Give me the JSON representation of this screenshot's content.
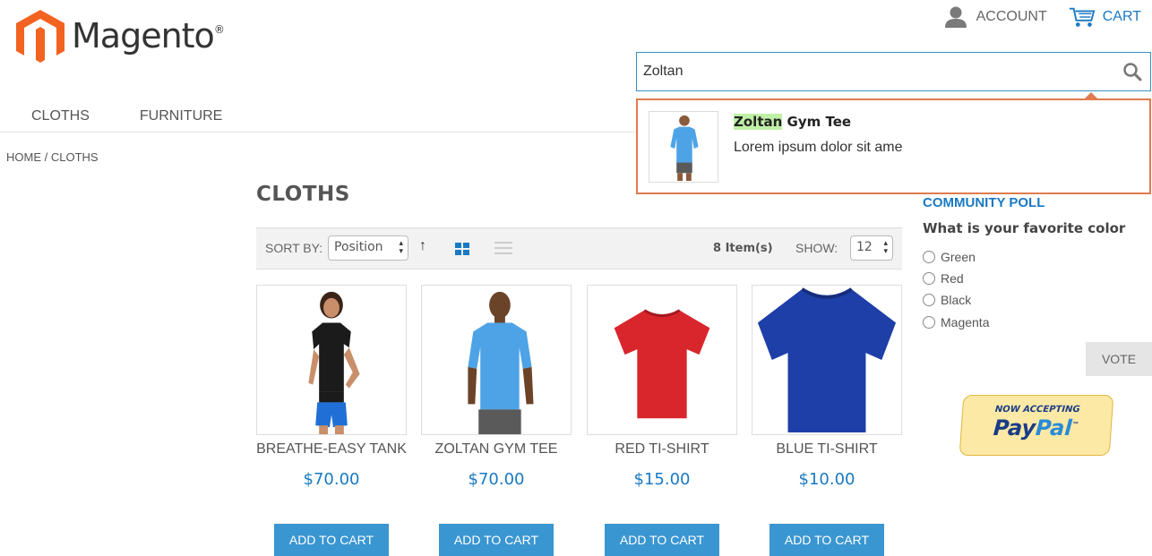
{
  "header": {
    "logo_text": "Magento",
    "logo_mark": "®",
    "account_label": "ACCOUNT",
    "cart_label": "CART"
  },
  "search": {
    "value": "Zoltan",
    "placeholder": ""
  },
  "suggestion": {
    "name_highlight": "Zoltan",
    "name_rest": " Gym Tee",
    "description": "Lorem ipsum dolor sit ame"
  },
  "nav": {
    "items": [
      {
        "label": "CLOTHS"
      },
      {
        "label": "FURNITURE"
      }
    ]
  },
  "breadcrumb": "HOME / CLOTHS",
  "page_title": "CLOTHS",
  "toolbar": {
    "sort_label": "SORT BY:",
    "sort_value": "Position",
    "sort_direction": "↑",
    "items_count": "8 Item(s)",
    "show_label": "SHOW:",
    "show_value": "12"
  },
  "products": [
    {
      "name": "BREATHE-EASY TANK",
      "price": "$70.00",
      "button": "ADD TO CART"
    },
    {
      "name": "ZOLTAN GYM TEE",
      "price": "$70.00",
      "button": "ADD TO CART"
    },
    {
      "name": "RED TI-SHIRT",
      "price": "$15.00",
      "button": "ADD TO CART"
    },
    {
      "name": "BLUE TI-SHIRT",
      "price": "$10.00",
      "button": "ADD TO CART"
    }
  ],
  "poll": {
    "title": "COMMUNITY POLL",
    "question": "What is your favorite color",
    "options": [
      "Green",
      "Red",
      "Black",
      "Magenta"
    ],
    "vote_label": "VOTE"
  },
  "paypal": {
    "top_text": "NOW ACCEPTING",
    "brand_pay": "Pay",
    "brand_pal": "Pal",
    "brand_tm": "™"
  },
  "colors": {
    "accent": "#1979c3",
    "button": "#3a96d1",
    "brand_orange": "#f26322",
    "dropdown_border": "#e07b4f",
    "highlight": "#bff0a6"
  }
}
